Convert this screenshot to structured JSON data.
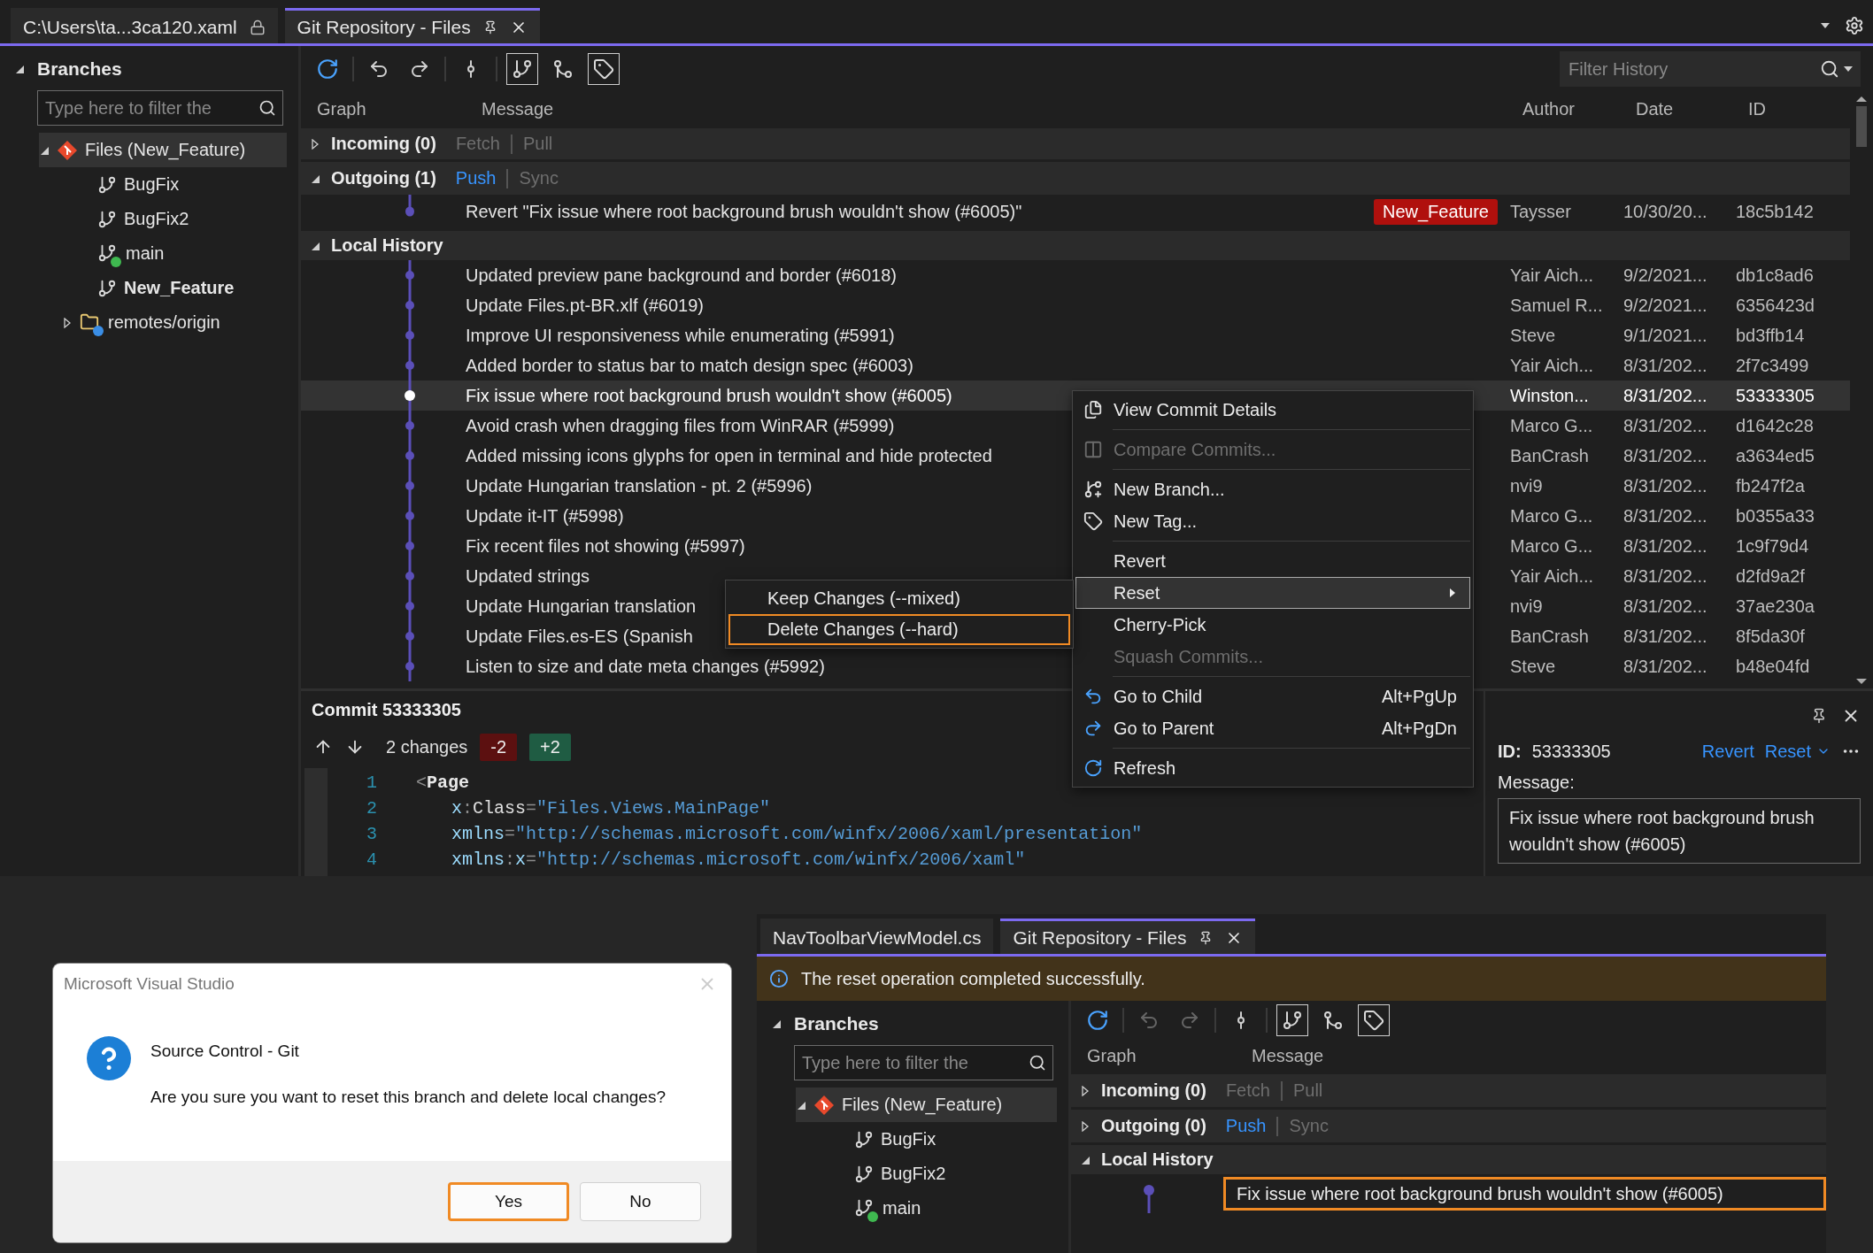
{
  "main_window": {
    "tabs": [
      {
        "label": "C:\\Users\\ta...3ca120.xaml",
        "selected": false,
        "locked": true
      },
      {
        "label": "Git Repository - Files",
        "selected": true,
        "locked": false
      }
    ],
    "branches_panel": {
      "title": "Branches",
      "expanded": true,
      "filter_placeholder": "Type here to filter the",
      "tree": [
        {
          "label": "Files (New_Feature)",
          "kind": "repo",
          "expanded": true,
          "selected": true,
          "current": false,
          "children": [
            {
              "label": "BugFix",
              "kind": "branch",
              "selected": false,
              "current": false
            },
            {
              "label": "BugFix2",
              "kind": "branch",
              "selected": false,
              "current": false
            },
            {
              "label": "main",
              "kind": "tracked_branch",
              "selected": false,
              "current": false
            },
            {
              "label": "New_Feature",
              "kind": "branch",
              "selected": false,
              "current": true
            },
            {
              "label": "remotes/origin",
              "kind": "remote",
              "expanded": false,
              "selected": false,
              "current": false
            }
          ]
        }
      ]
    },
    "toolbar": {
      "navigation_enabled": true,
      "toggles": [
        {
          "on": true
        },
        {
          "on": false
        },
        {
          "on": true
        }
      ]
    },
    "filter_history": {
      "placeholder": "Filter History"
    },
    "columns": [
      "Graph",
      "Message",
      "Author",
      "Date",
      "ID"
    ],
    "incoming": {
      "label": "Incoming (0)",
      "expanded": false,
      "actions": [
        {
          "label": "Fetch",
          "enabled": false
        },
        {
          "label": "Pull",
          "enabled": false
        }
      ]
    },
    "outgoing": {
      "label": "Outgoing (1)",
      "expanded": true,
      "actions": [
        {
          "label": "Push",
          "enabled": true
        },
        {
          "label": "Sync",
          "enabled": false
        }
      ],
      "commits": [
        {
          "message": "Revert \"Fix issue where root background brush wouldn't show (#6005)\"",
          "tag": "New_Feature",
          "author": "Taysser",
          "date": "10/30/20...",
          "id": "18c5b142",
          "selected": false
        }
      ]
    },
    "local_history": {
      "label": "Local History",
      "expanded": true,
      "commits": [
        {
          "message": "Updated preview pane background and border (#6018)",
          "author": "Yair Aich...",
          "date": "9/2/2021...",
          "id": "db1c8ad6",
          "selected": false
        },
        {
          "message": "Update Files.pt-BR.xlf (#6019)",
          "author": "Samuel R...",
          "date": "9/2/2021...",
          "id": "6356423d",
          "selected": false
        },
        {
          "message": "Improve UI responsiveness while enumerating (#5991)",
          "author": "Steve",
          "date": "9/1/2021...",
          "id": "bd3ffb14",
          "selected": false
        },
        {
          "message": "Added border to status bar to match design spec (#6003)",
          "author": "Yair Aich...",
          "date": "8/31/202...",
          "id": "2f7c3499",
          "selected": false
        },
        {
          "message": "Fix issue where root background brush wouldn't show (#6005)",
          "author": "Winston...",
          "date": "8/31/202...",
          "id": "53333305",
          "selected": true
        },
        {
          "message": "Avoid crash when dragging files from WinRAR (#5999)",
          "author": "Marco G...",
          "date": "8/31/202...",
          "id": "d1642c28",
          "selected": false
        },
        {
          "message": "Added missing icons glyphs for open in terminal and hide protected",
          "author": "BanCrash",
          "date": "8/31/202...",
          "id": "a3634ed5",
          "selected": false
        },
        {
          "message": "Update Hungarian translation - pt. 2 (#5996)",
          "author": "nvi9",
          "date": "8/31/202...",
          "id": "fb247f2a",
          "selected": false
        },
        {
          "message": "Update it-IT (#5998)",
          "author": "Marco G...",
          "date": "8/31/202...",
          "id": "b0355a33",
          "selected": false
        },
        {
          "message": "Fix recent files not showing (#5997)",
          "author": "Marco G...",
          "date": "8/31/202...",
          "id": "1c9f79d4",
          "selected": false
        },
        {
          "message": "Updated strings",
          "author": "Yair Aich...",
          "date": "8/31/202...",
          "id": "d2fd9a2f",
          "selected": false
        },
        {
          "message": "Update Hungarian translation",
          "author": "nvi9",
          "date": "8/31/202...",
          "id": "37ae230a",
          "selected": false
        },
        {
          "message": "Update Files.es-ES (Spanish",
          "author": "BanCrash",
          "date": "8/31/202...",
          "id": "8f5da30f",
          "selected": false
        },
        {
          "message": "Listen to size and date meta changes (#5992)",
          "author": "Steve",
          "date": "8/31/202...",
          "id": "b48e04fd",
          "selected": false
        }
      ]
    },
    "commit_details": {
      "title": "Commit 53333305",
      "changes": "2 changes",
      "removed": "-2",
      "added": "+2",
      "code": [
        {
          "number": "1",
          "tokens": [
            {
              "kind": "punct",
              "text": "<"
            },
            {
              "kind": "tag",
              "text": "Page"
            }
          ]
        },
        {
          "number": "2",
          "tokens": [
            {
              "kind": "prefix",
              "text": "x"
            },
            {
              "kind": "punct",
              "text": ":"
            },
            {
              "kind": "attr",
              "text": "Class"
            },
            {
              "kind": "punct",
              "text": "="
            },
            {
              "kind": "value",
              "text": "\"Files.Views.MainPage\""
            }
          ]
        },
        {
          "number": "3",
          "tokens": [
            {
              "kind": "prefix",
              "text": "xmlns"
            },
            {
              "kind": "punct",
              "text": "="
            },
            {
              "kind": "value",
              "text": "\"http://schemas.microsoft.com/winfx/2006/xaml/presentation\""
            }
          ]
        },
        {
          "number": "4",
          "tokens": [
            {
              "kind": "prefix",
              "text": "xmlns"
            },
            {
              "kind": "punct",
              "text": ":"
            },
            {
              "kind": "prefix",
              "text": "x"
            },
            {
              "kind": "punct",
              "text": "="
            },
            {
              "kind": "value",
              "text": "\"http://schemas.microsoft.com/winfx/2006/xaml\""
            }
          ]
        }
      ],
      "id_label": "ID:",
      "id": "53333305",
      "actions": [
        "Revert",
        "Reset"
      ],
      "message_label": "Message:",
      "message": "Fix issue where root background brush wouldn't show (#6005)"
    },
    "context_menu": {
      "items": [
        {
          "kind": "command",
          "label": "View Commit Details",
          "disabled": false,
          "selected": false
        },
        {
          "kind": "separator"
        },
        {
          "kind": "command",
          "label": "Compare Commits...",
          "disabled": true,
          "selected": false
        },
        {
          "kind": "separator"
        },
        {
          "kind": "command",
          "label": "New Branch...",
          "disabled": false,
          "selected": false
        },
        {
          "kind": "command",
          "label": "New Tag...",
          "disabled": false,
          "selected": false
        },
        {
          "kind": "separator"
        },
        {
          "kind": "command",
          "label": "Revert",
          "disabled": false,
          "selected": false
        },
        {
          "kind": "submenu",
          "label": "Reset",
          "disabled": false,
          "selected": true
        },
        {
          "kind": "command",
          "label": "Cherry-Pick",
          "disabled": false,
          "selected": false
        },
        {
          "kind": "command",
          "label": "Squash Commits...",
          "disabled": true,
          "selected": false
        },
        {
          "kind": "separator"
        },
        {
          "kind": "command",
          "label": "Go to Child",
          "shortcut": "Alt+PgUp",
          "disabled": false,
          "selected": false
        },
        {
          "kind": "command",
          "label": "Go to Parent",
          "shortcut": "Alt+PgDn",
          "disabled": false,
          "selected": false
        },
        {
          "kind": "separator"
        },
        {
          "kind": "command",
          "label": "Refresh",
          "disabled": false,
          "selected": false
        }
      ]
    },
    "reset_submenu": {
      "items": [
        {
          "label": "Keep Changes (--mixed)",
          "selected": false
        },
        {
          "label": "Delete Changes (--hard)",
          "selected": true
        }
      ]
    }
  },
  "dialog": {
    "title": "Microsoft Visual Studio",
    "heading": "Source Control - Git",
    "message": "Are you sure you want to reset this branch and delete local changes?",
    "buttons": [
      {
        "label": "Yes",
        "selected": true
      },
      {
        "label": "No",
        "selected": false
      }
    ]
  },
  "second_window": {
    "tabs": [
      {
        "label": "NavToolbarViewModel.cs",
        "selected": false,
        "locked": false
      },
      {
        "label": "Git Repository - Files",
        "selected": true,
        "locked": false
      }
    ],
    "info_bar": "The reset operation completed successfully.",
    "branches_panel": {
      "title": "Branches",
      "expanded": true,
      "filter_placeholder": "Type here to filter the",
      "tree": [
        {
          "label": "Files (New_Feature)",
          "kind": "repo",
          "expanded": true,
          "selected": true,
          "current": false,
          "children": [
            {
              "label": "BugFix",
              "kind": "branch",
              "selected": false,
              "current": false
            },
            {
              "label": "BugFix2",
              "kind": "branch",
              "selected": false,
              "current": false
            },
            {
              "label": "main",
              "kind": "tracked_branch",
              "selected": false,
              "current": false
            }
          ]
        }
      ]
    },
    "toolbar": {
      "navigation_enabled": false,
      "toggles": [
        {
          "on": true
        },
        {
          "on": false
        },
        {
          "on": true
        }
      ]
    },
    "columns": [
      "Graph",
      "Message"
    ],
    "incoming": {
      "label": "Incoming (0)",
      "expanded": false,
      "actions": [
        {
          "label": "Fetch",
          "enabled": false
        },
        {
          "label": "Pull",
          "enabled": false
        }
      ]
    },
    "outgoing": {
      "label": "Outgoing (0)",
      "expanded": false,
      "actions": [
        {
          "label": "Push",
          "enabled": true
        },
        {
          "label": "Sync",
          "enabled": false
        }
      ]
    },
    "local_history": {
      "label": "Local History",
      "expanded": true,
      "commits": [
        {
          "message": "Fix issue where root background brush wouldn't show (#6005)",
          "selected": true
        }
      ]
    }
  }
}
